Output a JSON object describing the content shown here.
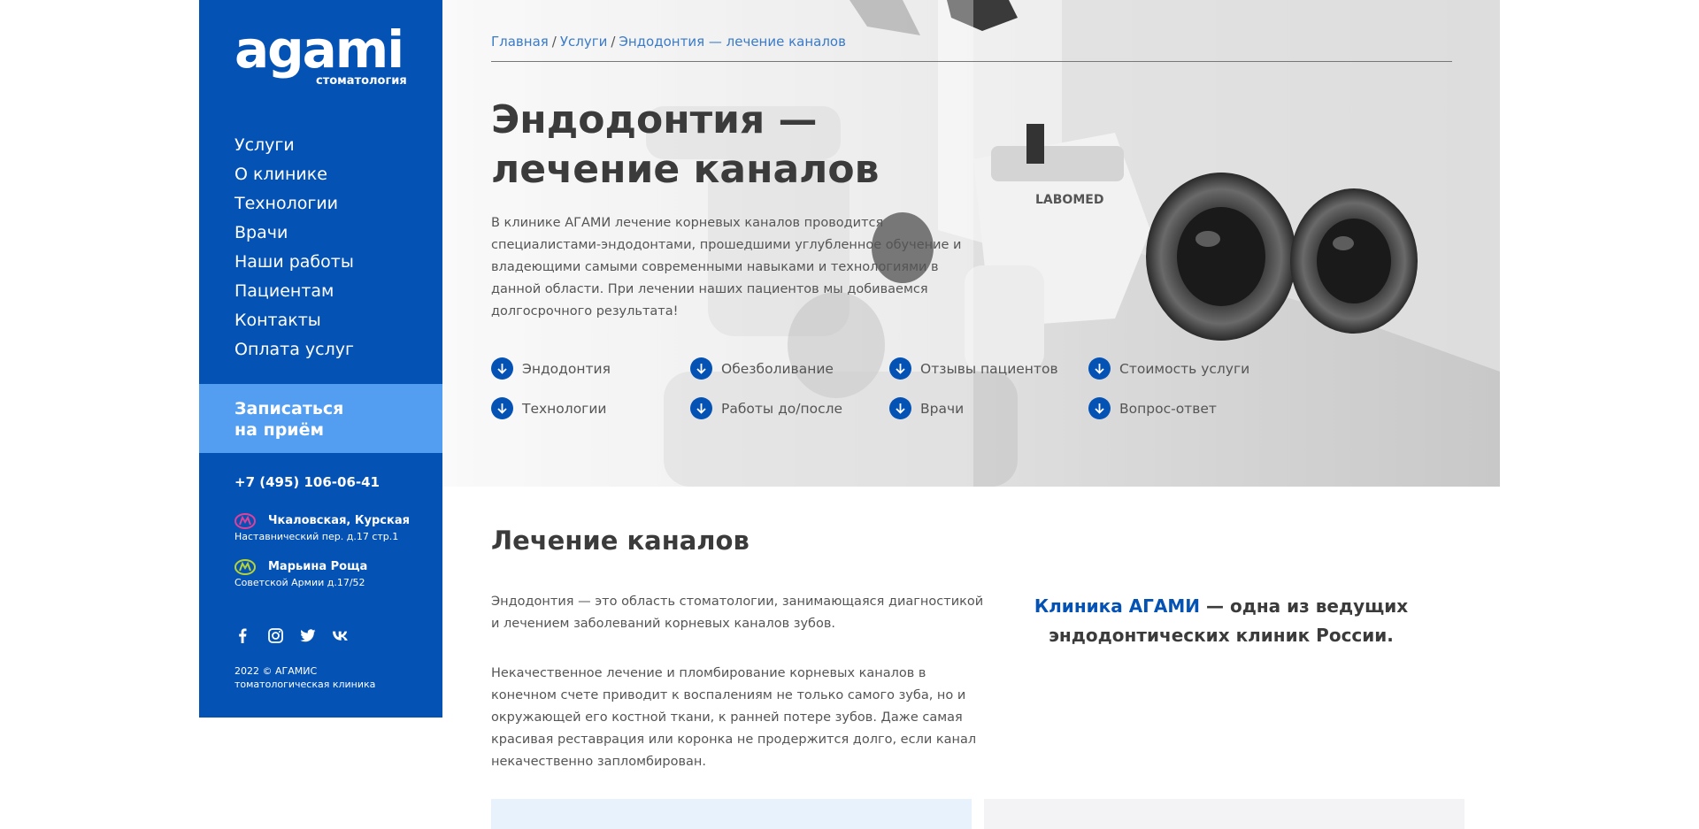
{
  "sidebar": {
    "logo_word": "agami",
    "logo_sub": "стоматология",
    "nav": [
      "Услуги",
      "О клинике",
      "Технологии",
      "Врачи",
      "Наши работы",
      "Пациентам",
      "Контакты",
      "Оплата услуг"
    ],
    "cta_line1": "Записаться",
    "cta_line2": "на приём",
    "phone": "+7 (495) 106-06-41",
    "metro": [
      {
        "name": "Чкаловская, Курская",
        "address": "Наставнический пер. д.17 стр.1",
        "color": "#e0409a"
      },
      {
        "name": "Марьина Роща",
        "address": "Советской Армии д.17/52",
        "color": "#b5d334"
      }
    ],
    "socials": [
      "facebook-icon",
      "instagram-icon",
      "twitter-icon",
      "vk-icon"
    ],
    "copyright": "2022 © АГАМИС томатологическая клиника"
  },
  "hero": {
    "breadcrumb": [
      "Главная",
      "Услуги",
      "Эндодонтия — лечение каналов"
    ],
    "title_line1": "Эндодонтия —",
    "title_line2": "лечение каналов",
    "lead": "В клинике АГАМИ лечение корневых каналов проводится специалистами-эндодонтами, прошедшими углубленное обучение и владеющими самыми современными навыками и технологиями в данной области. При лечении наших пациентов мы добиваемся долгосрочного результата!",
    "anchors": [
      "Эндодонтия",
      "Обезболивание",
      "Отзывы пациентов",
      "Стоимость услуги",
      "Технологии",
      "Работы до/после",
      "Врачи",
      "Вопрос-ответ"
    ],
    "microscope_brand": "LABOMED"
  },
  "content": {
    "heading": "Лечение каналов",
    "p1": "Эндодонтия — это область стоматологии, занимающаяся диагностикой и лечением заболеваний корневых каналов зубов.",
    "p2": "Некачественное лечение и пломбирование корневых каналов в конечном счете приводит к воспалениям не только самого зуба, но и окружающей его костной ткани, к ранней потере зубов. Даже самая красивая реставрация или коронка не продержится долго, если канал некачественно запломбирован.",
    "quote_highlight": "Клиника АГАМИ",
    "quote_rest": "— одна из ведущих эндодонтических клиник России."
  },
  "colors": {
    "brand_blue": "#0552b5",
    "cta_blue": "#539ef0"
  }
}
